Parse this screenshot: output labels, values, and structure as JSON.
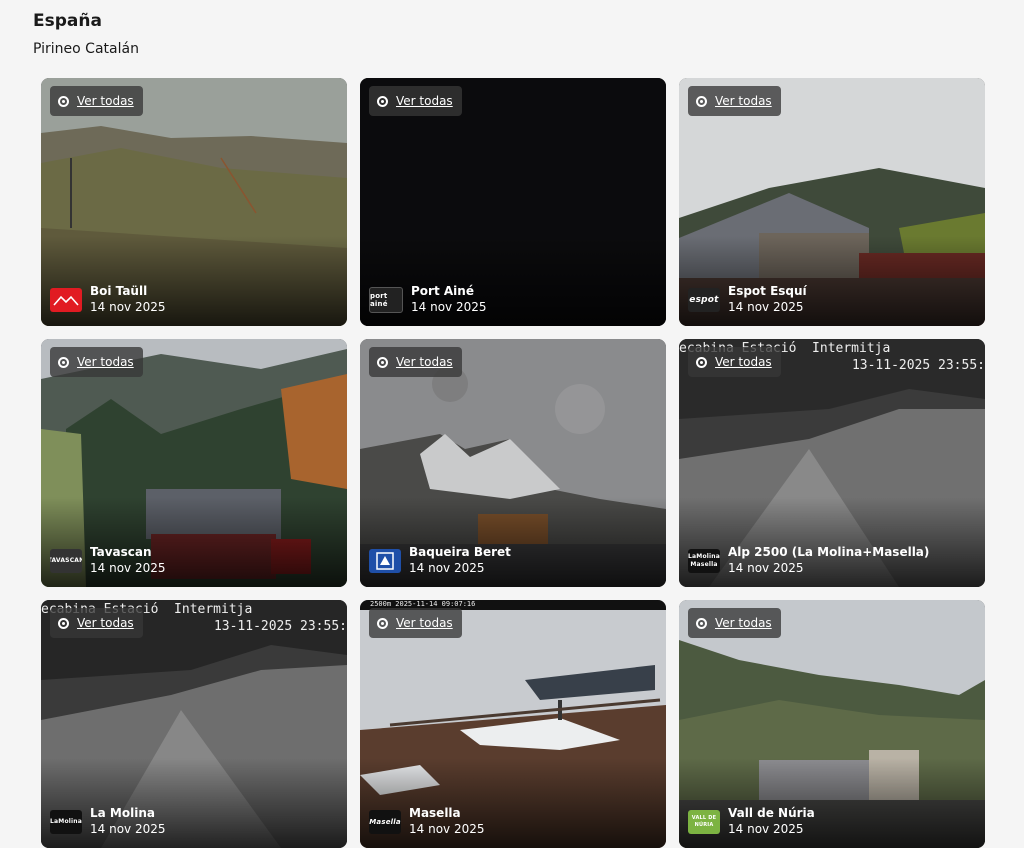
{
  "country": "España",
  "region": "Pirineo Catalán",
  "view_all_label": "Ver todas",
  "cards": [
    {
      "name": "Boi Taüll",
      "date": "14 nov 2025",
      "logo_text": "",
      "logo_bg": "#e11b22"
    },
    {
      "name": "Port Ainé",
      "date": "14 nov 2025",
      "logo_text": "port ainé",
      "logo_bg": "#222222"
    },
    {
      "name": "Espot Esquí",
      "date": "14 nov 2025",
      "logo_text": "espot",
      "logo_bg": "#222222"
    },
    {
      "name": "Tavascan",
      "date": "14 nov 2025",
      "logo_text": "TAVASCAN",
      "logo_bg": "#333333"
    },
    {
      "name": "Baqueira Beret",
      "date": "14 nov 2025",
      "logo_text": "",
      "logo_bg": "#1f4fa8"
    },
    {
      "name": "Alp 2500 (La Molina+Masella)",
      "date": "14 nov 2025",
      "logo_text": "LaMolina Masella",
      "logo_bg": "#111111",
      "overlay_line1": "ecabina Estació  Intermitja",
      "overlay_line2": "13-11-2025 23:55:"
    },
    {
      "name": "La Molina",
      "date": "14 nov 2025",
      "logo_text": "LaMolina",
      "logo_bg": "#111111",
      "overlay_line1": "ecabina Estació  Intermitja",
      "overlay_line2": "13-11-2025 23:55:"
    },
    {
      "name": "Masella",
      "date": "14 nov 2025",
      "logo_text": "Masella",
      "logo_bg": "#111111",
      "overlay_line1": "2500m 2025-11-14 09:07:16"
    },
    {
      "name": "Vall de Núria",
      "date": "14 nov 2025",
      "logo_text": "VALL DE NÚRIA",
      "logo_bg": "#7cb342"
    }
  ]
}
